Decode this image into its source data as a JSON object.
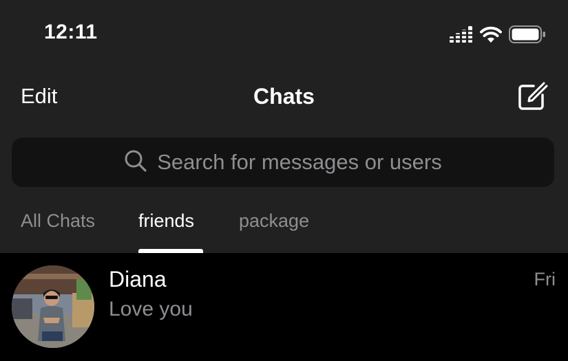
{
  "status_bar": {
    "time": "12:11",
    "signal_icon": "signal-bars-icon",
    "wifi_icon": "wifi-icon",
    "battery_icon": "battery-icon"
  },
  "nav": {
    "edit_label": "Edit",
    "title": "Chats",
    "compose_icon": "compose-icon"
  },
  "search": {
    "placeholder": "Search for messages or users",
    "icon": "search-icon"
  },
  "tabs": [
    {
      "label": "All Chats",
      "active": false
    },
    {
      "label": "friends",
      "active": true
    },
    {
      "label": "package",
      "active": false
    }
  ],
  "chats": [
    {
      "name": "Diana",
      "preview": "Love you",
      "time": "Fri",
      "avatar": "profile-photo"
    }
  ],
  "colors": {
    "header_bg": "#212121",
    "list_bg": "#000000",
    "search_bg": "#121212",
    "secondary_text": "#8e8e93",
    "primary_text": "#ffffff"
  }
}
